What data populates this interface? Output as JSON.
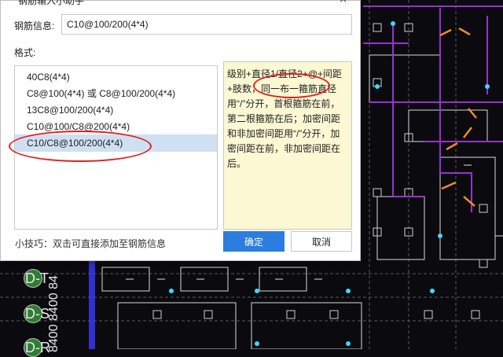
{
  "dialog": {
    "title": "钢筋输入小助手",
    "close_glyph": "×",
    "rebar_info_label": "钢筋信息:",
    "rebar_info_value": "C10@100/200(4*4)",
    "format_label": "格式:",
    "formats": [
      {
        "label": "40C8(4*4)",
        "selected": false
      },
      {
        "label": "C8@100(4*4) 或 C8@100/200(4*4)",
        "selected": false
      },
      {
        "label": "13C8@100/200(4*4)",
        "selected": false
      },
      {
        "label": "C10@100/C8@200(4*4)",
        "selected": false
      },
      {
        "label": "C10/C8@100/200(4*4)",
        "selected": true
      }
    ],
    "description": "级别+直径1/直径2+@+间距+肢数，同一布一箍筋直径用“/”分开，首根箍筋在前，第二根箍筋在后；加密间距和非加密间距用“/”分开，加密间距在前，非加密间距在后。",
    "tip": "小技巧：双击可直接添加至钢筋信息",
    "ok_label": "确定",
    "cancel_label": "取消"
  },
  "cad": {
    "axis_labels": [
      "D-T",
      "D-S",
      "D-R"
    ],
    "dimension_text": "8400 8400 84",
    "colors": {
      "background": "#0b0b0f",
      "purple": "#9b30d0",
      "orange": "#f08a24",
      "cyan": "#3fd6ff",
      "white": "#e8e8e8",
      "green": "#2e7d32"
    }
  },
  "annotation_color": "#e02020"
}
